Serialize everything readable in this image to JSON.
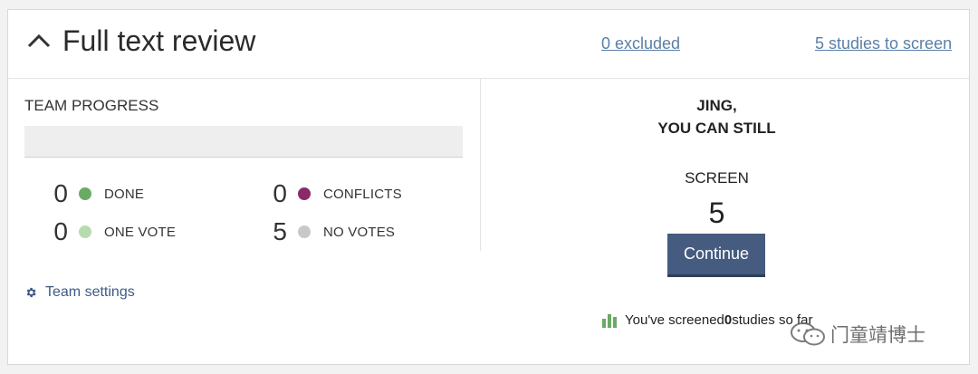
{
  "header": {
    "title": "Full text review",
    "excluded_link": "0 excluded",
    "studies_link": "5 studies to screen"
  },
  "progress": {
    "label": "TEAM PROGRESS",
    "fill_fraction": 0,
    "stats": [
      {
        "count": "0",
        "label": "DONE",
        "color": "#6aaa64"
      },
      {
        "count": "0",
        "label": "CONFLICTS",
        "color": "#8b2a6b"
      },
      {
        "count": "0",
        "label": "ONE VOTE",
        "color": "#b6dcae"
      },
      {
        "count": "5",
        "label": "NO VOTES",
        "color": "#c8c8c8"
      }
    ]
  },
  "team_settings": {
    "label": "Team settings",
    "icon": "gear-icon"
  },
  "right": {
    "greeting_line1": "JING,",
    "greeting_line2": "YOU CAN STILL",
    "screen_label": "SCREEN",
    "screen_count": "5",
    "continue_label": "Continue",
    "screened_prefix": "You've screened ",
    "screened_count": "0",
    "screened_suffix": " studies so far"
  },
  "watermark": {
    "text": "门童靖博士",
    "icon": "wechat-icon"
  },
  "colors": {
    "accent": "#455b7f",
    "link": "#5b7fa6"
  }
}
